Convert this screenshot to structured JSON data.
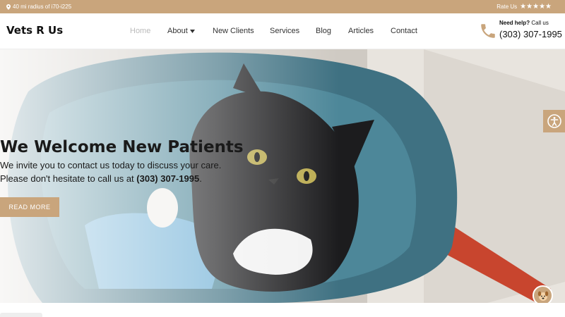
{
  "topbar": {
    "location_text": "40 mi radius of i70-i225",
    "rate_label": "Rate Us",
    "stars": "★★★★★",
    "location_icon": "map-pin-icon"
  },
  "header": {
    "logo": "Vets R Us",
    "nav": {
      "home": "Home",
      "about": "About",
      "new_clients": "New Clients",
      "services": "Services",
      "blog": "Blog",
      "articles": "Articles",
      "contact": "Contact"
    },
    "help_bold": "Need help?",
    "help_text": "Call us",
    "phone": "(303) 307-1995"
  },
  "hero": {
    "title": "We Welcome New Patients",
    "line1": "We invite you to contact us today to discuss your care.",
    "line2_prefix": "Please don't hesitate to call us at ",
    "line2_phone": "(303) 307-1995",
    "line2_suffix": ".",
    "button": "READ MORE"
  },
  "colors": {
    "accent": "#c9a57c",
    "text": "#1a1a1a"
  }
}
